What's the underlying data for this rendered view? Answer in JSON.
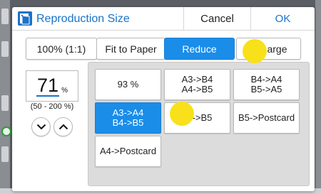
{
  "dialog": {
    "title": "Reproduction Size",
    "cancel_label": "Cancel",
    "ok_label": "OK"
  },
  "modes": {
    "actual_size": "100% (1:1)",
    "fit_to_paper": "Fit to Paper",
    "reduce": "Reduce",
    "enlarge": "arge",
    "selected": "reduce"
  },
  "zoom": {
    "value": "71",
    "unit": "%",
    "range": "(50 - 200 %)"
  },
  "presets": [
    {
      "line1": "93 %",
      "line2": ""
    },
    {
      "line1": "A3->B4",
      "line2": "A4->B5"
    },
    {
      "line1": "B4->A4",
      "line2": "B5->A5"
    },
    {
      "line1": "A3->A4",
      "line2": "B4->B5"
    },
    {
      "line1": "->B5",
      "line2": ""
    },
    {
      "line1": "B5->Postcard",
      "line2": ""
    },
    {
      "line1": "A4->Postcard",
      "line2": ""
    }
  ],
  "selected_preset": 3,
  "colors": {
    "accent": "#1a8de9",
    "title": "#1a72c9",
    "touch_indicator": "#f8e11a"
  }
}
